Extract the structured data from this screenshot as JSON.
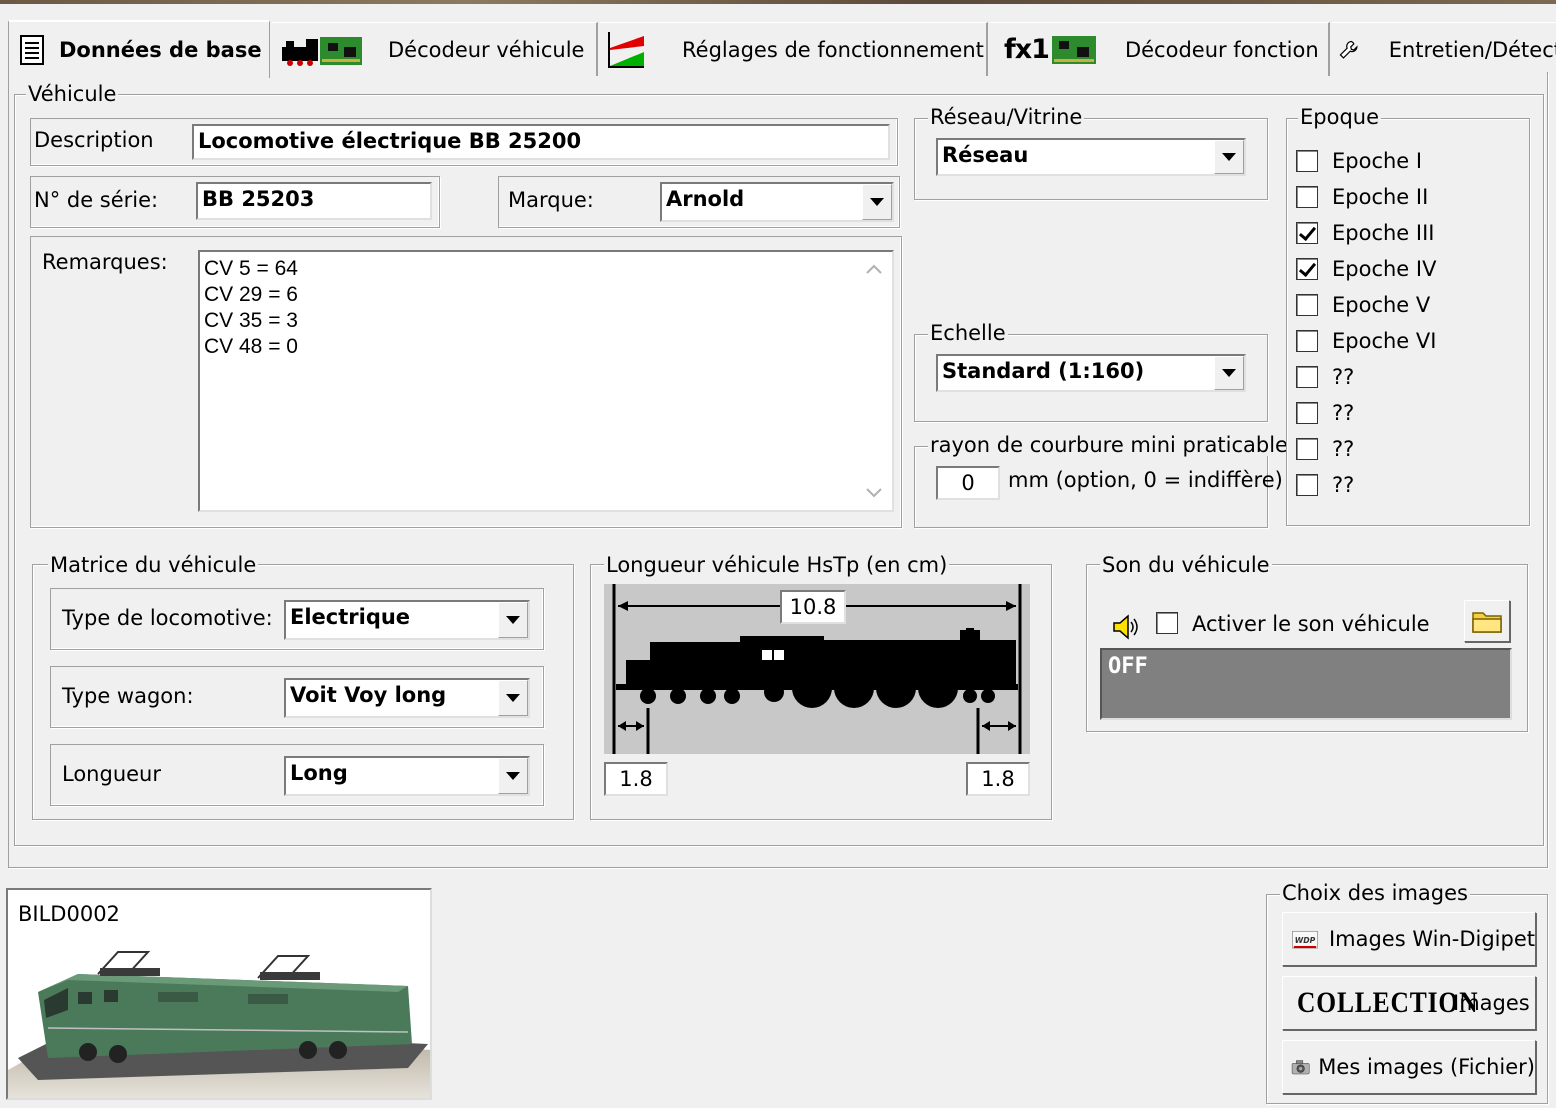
{
  "tabs": [
    {
      "label": "Données de base",
      "active": true
    },
    {
      "label": "Décodeur véhicule"
    },
    {
      "label": "Réglages de fonctionnement"
    },
    {
      "label": "Décodeur fonction"
    },
    {
      "label": "Entretien/Détect"
    }
  ],
  "tab_fx_prefix": "fx1",
  "vehicle": {
    "group_label": "Véhicule",
    "description_label": "Description",
    "description_value": "Locomotive électrique BB 25200",
    "serial_label": "N° de série:",
    "serial_value": "BB 25203",
    "brand_label": "Marque:",
    "brand_value": "Arnold",
    "remarks_label": "Remarques:",
    "remarks_lines": [
      "CV 5 = 64",
      "CV 29 = 6",
      "CV 35 = 3",
      "CV 48 = 0"
    ]
  },
  "network": {
    "group_label": "Réseau/Vitrine",
    "value": "Réseau"
  },
  "scale": {
    "group_label": "Echelle",
    "value": "Standard (1:160)"
  },
  "radius": {
    "group_label": "rayon de courbure mini praticable",
    "value": "0",
    "unit_text": "mm (option, 0 = indiffère)"
  },
  "epoch": {
    "group_label": "Epoque",
    "items": [
      {
        "label": "Epoche I",
        "checked": false
      },
      {
        "label": "Epoche II",
        "checked": false
      },
      {
        "label": "Epoche III",
        "checked": true
      },
      {
        "label": "Epoche IV",
        "checked": true
      },
      {
        "label": "Epoche V",
        "checked": false
      },
      {
        "label": "Epoche VI",
        "checked": false
      },
      {
        "label": "??",
        "checked": false
      },
      {
        "label": "??",
        "checked": false
      },
      {
        "label": "??",
        "checked": false
      },
      {
        "label": "??",
        "checked": false
      }
    ]
  },
  "matrix": {
    "group_label": "Matrice du véhicule",
    "loco_type_label": "Type de locomotive:",
    "loco_type_value": "Electrique",
    "wagon_type_label": "Type wagon:",
    "wagon_type_value": "Voit Voy long",
    "length_label": "Longueur",
    "length_value": "Long"
  },
  "vehicle_length": {
    "group_label": "Longueur véhicule HsTp (en cm)",
    "total": "10.8",
    "left_offset": "1.8",
    "right_offset": "1.8"
  },
  "sound": {
    "group_label": "Son du véhicule",
    "enable_label": "Activer le son véhicule",
    "enabled": false,
    "status": "OFF"
  },
  "image": {
    "name": "BILD0002"
  },
  "images": {
    "group_label": "Choix des images",
    "wdp_button": "Images Win-Digipet",
    "collection_logo": "COLLECTION",
    "collection_button": "Images",
    "files_button": "Mes images (Fichier)"
  },
  "colors": {
    "accent_green": "#00a000",
    "accent_red": "#e00000",
    "sound_panel": "#808080",
    "loco_green": "#4a7a5a"
  }
}
